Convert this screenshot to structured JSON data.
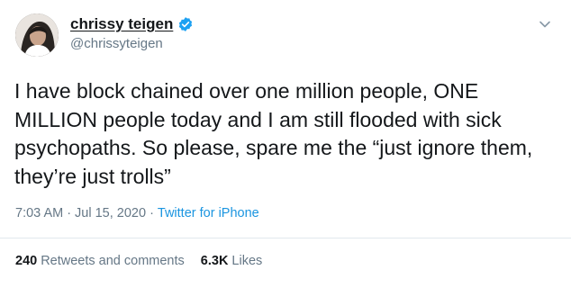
{
  "header": {
    "display_name": "chrissy teigen",
    "handle": "@chrissyteigen",
    "verified_icon": "verified-badge-icon",
    "menu_icon": "chevron-down-icon"
  },
  "tweet": {
    "text": "I have block chained over one million people, ONE\nMILLION people today and I am still flooded with sick\npsychopaths. So please, spare me the “just ignore them,\nthey’re just trolls”"
  },
  "meta": {
    "time": "7:03 AM",
    "sep1": "·",
    "date": "Jul 15, 2020",
    "sep2": "·",
    "source": "Twitter for iPhone"
  },
  "stats": {
    "retweets_count": "240",
    "retweets_label": "Retweets and comments",
    "likes_count": "6.3K",
    "likes_label": "Likes"
  },
  "colors": {
    "text_primary": "#14171a",
    "text_secondary": "#657786",
    "link": "#1b95e0",
    "verified": "#1da1f2",
    "divider": "#e1e8ed"
  }
}
